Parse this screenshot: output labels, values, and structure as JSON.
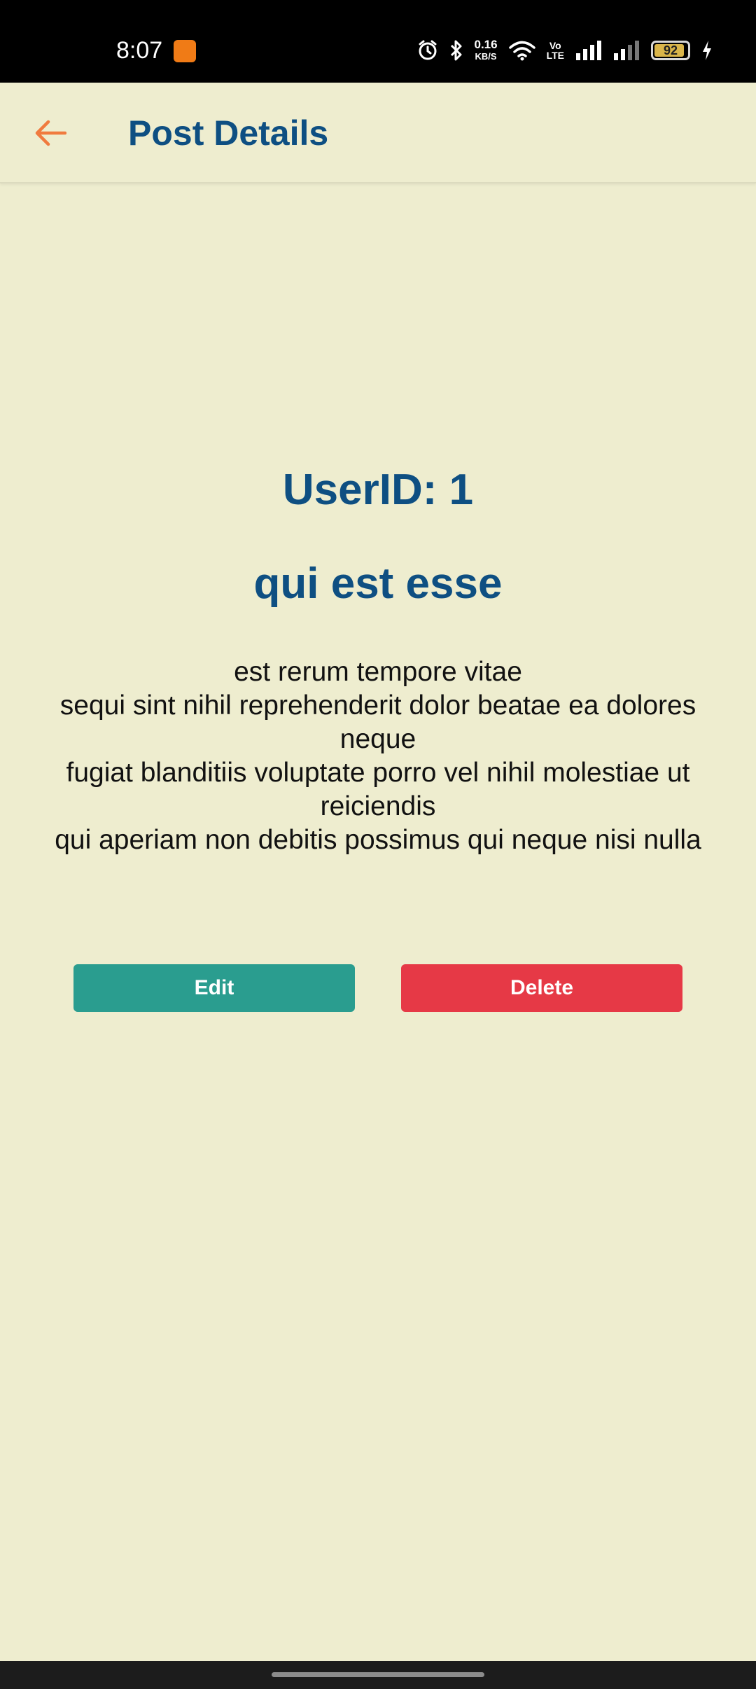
{
  "status_bar": {
    "time": "8:07",
    "net_speed_value": "0.16",
    "net_speed_unit": "KB/S",
    "volte_top": "Vo",
    "volte_bottom": "LTE",
    "battery_level": "92",
    "icons": [
      "alarm-icon",
      "bluetooth-icon",
      "wifi-icon",
      "signal-icon",
      "battery-icon",
      "charging-icon"
    ]
  },
  "app_bar": {
    "title": "Post Details",
    "back_icon": "arrow-left-icon"
  },
  "post": {
    "user_id_label": "UserID: 1",
    "title": "qui est esse",
    "body": "est rerum tempore vitae\nsequi sint nihil reprehenderit dolor beatae ea dolores neque\nfugiat blanditiis voluptate porro vel nihil molestiae ut reiciendis\nqui aperiam non debitis possimus qui neque nisi nulla"
  },
  "actions": {
    "edit_label": "Edit",
    "delete_label": "Delete"
  },
  "colors": {
    "background": "#eeedcf",
    "primary_text": "#0e4f82",
    "accent": "#f07b3f",
    "edit_button": "#2a9d8f",
    "delete_button": "#e63946"
  }
}
